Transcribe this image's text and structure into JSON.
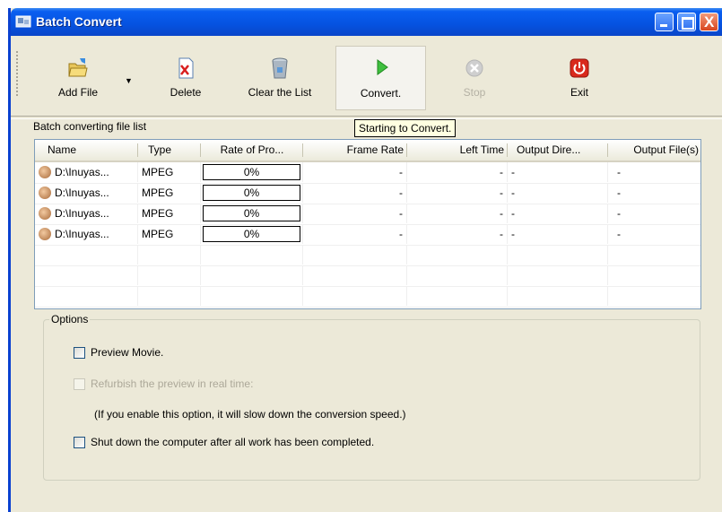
{
  "window": {
    "title": "Batch Convert",
    "close_glyph": "X"
  },
  "toolbar": {
    "buttons": [
      {
        "label": "Add File",
        "icon": "folder-add-icon",
        "enabled": true
      },
      {
        "label": "Delete",
        "icon": "delete-file-icon",
        "enabled": true
      },
      {
        "label": "Clear the List",
        "icon": "recycle-bin-icon",
        "enabled": true
      },
      {
        "label": "Convert.",
        "icon": "play-icon",
        "enabled": true,
        "active": true
      },
      {
        "label": "Stop",
        "icon": "stop-icon",
        "enabled": false
      },
      {
        "label": "Exit",
        "icon": "power-icon",
        "enabled": true
      }
    ],
    "dropdown_glyph": "▼"
  },
  "file_list": {
    "label": "Batch converting file list",
    "tooltip": "Starting to Convert.",
    "columns": [
      "Name",
      "Type",
      "Rate of Pro...",
      "Frame Rate",
      "Left Time",
      "Output Dire...",
      "Output File(s)"
    ],
    "rows": [
      {
        "name": "D:\\Inuyas...",
        "type": "MPEG",
        "rate": "0%",
        "frame_rate": "-",
        "left_time": "-",
        "output_dir": "-",
        "output_file": "-"
      },
      {
        "name": "D:\\Inuyas...",
        "type": "MPEG",
        "rate": "0%",
        "frame_rate": "-",
        "left_time": "-",
        "output_dir": "-",
        "output_file": "-"
      },
      {
        "name": "D:\\Inuyas...",
        "type": "MPEG",
        "rate": "0%",
        "frame_rate": "-",
        "left_time": "-",
        "output_dir": "-",
        "output_file": "-"
      },
      {
        "name": "D:\\Inuyas...",
        "type": "MPEG",
        "rate": "0%",
        "frame_rate": "-",
        "left_time": "-",
        "output_dir": "-",
        "output_file": "-"
      }
    ]
  },
  "options": {
    "legend": "Options",
    "preview_movie": {
      "label": "Preview Movie.",
      "checked": false,
      "enabled": true
    },
    "refurbish": {
      "label": "Refurbish the preview in real time:",
      "checked": false,
      "enabled": false
    },
    "refurbish_note": "(If you enable this option, it will slow down the conversion speed.)",
    "shutdown": {
      "label": "Shut down the computer after all work has been completed.",
      "checked": false,
      "enabled": true
    }
  }
}
